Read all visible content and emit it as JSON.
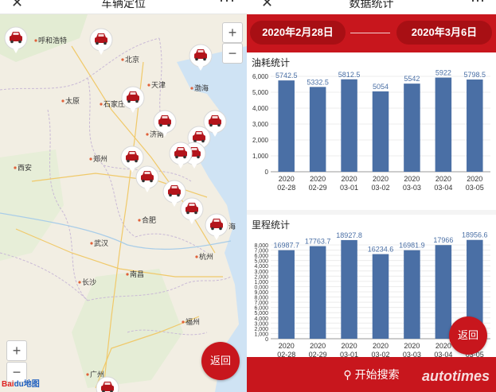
{
  "left": {
    "title": "车辆定位",
    "close_icon": "close-icon",
    "more_icon": "more-icon",
    "zoom_in": "+",
    "zoom_out": "−",
    "zoom_in_bottom": "+",
    "zoom_out_bottom": "−",
    "back_label": "返回",
    "attribution_a": "Bai",
    "attribution_b": "du地图",
    "cities": [
      {
        "name": "呼和浩特"
      },
      {
        "name": "北京"
      },
      {
        "name": "天津"
      },
      {
        "name": "太原"
      },
      {
        "name": "石家庄"
      },
      {
        "name": "济南"
      },
      {
        "name": "渤海"
      },
      {
        "name": "西安"
      },
      {
        "name": "郑州"
      },
      {
        "name": "合肥"
      },
      {
        "name": "武汉"
      },
      {
        "name": "杭州"
      },
      {
        "name": "长沙"
      },
      {
        "name": "南昌"
      },
      {
        "name": "福州"
      },
      {
        "name": "广州"
      },
      {
        "name": "海"
      }
    ],
    "vehicle_marker_icon": "car-marker-icon"
  },
  "right": {
    "title": "数据统计",
    "date_start": "2020年2月28日",
    "date_end": "2020年3月6日",
    "back_label": "返回",
    "search_label": "开始搜索",
    "search_icon": "search-icon",
    "watermark": "autotimes",
    "accent": "#c8161d",
    "bar_color": "#4a6fa5"
  },
  "chart_data": [
    {
      "type": "bar",
      "title": "油耗统计",
      "categories": [
        "2020 02-28",
        "2020 02-29",
        "2020 03-01",
        "2020 03-02",
        "2020 03-03",
        "2020 03-04",
        "2020 03-05"
      ],
      "values": [
        5742.5,
        5332.5,
        5812.5,
        5054,
        5542,
        5922,
        5798.5
      ],
      "value_labels": [
        "5742.5",
        "5332.5",
        "5812.5",
        "5054",
        "5542",
        "5922",
        "5798.5"
      ],
      "yticks": [
        "0",
        "1,000",
        "2,000",
        "3,000",
        "4,000",
        "5,000",
        "6,000"
      ],
      "ylim": [
        0,
        6000
      ]
    },
    {
      "type": "bar",
      "title": "里程统计",
      "categories": [
        "2020 02-28",
        "2020 02-29",
        "2020 03-01",
        "2020 03-02",
        "2020 03-03",
        "2020 03-04",
        "2020 03-05"
      ],
      "values": [
        16987.7,
        17763.7,
        18927.8,
        16234.6,
        16981.9,
        17966,
        18956.6
      ],
      "value_labels": [
        "16987.7",
        "17763.7",
        "18927.8",
        "16234.6",
        "16981.9",
        "17966",
        "18956.6"
      ],
      "yticks": [
        "0",
        "1,000",
        "2,000",
        "3,000",
        "4,000",
        "5,000",
        "6,000",
        "7,000",
        "8,000",
        "9,000",
        "0,000",
        "1,000",
        "2,000",
        "3,000",
        "4,000",
        "5,000",
        "6,000",
        "7,000",
        "8,000"
      ],
      "ylim": [
        0,
        18000
      ]
    }
  ]
}
